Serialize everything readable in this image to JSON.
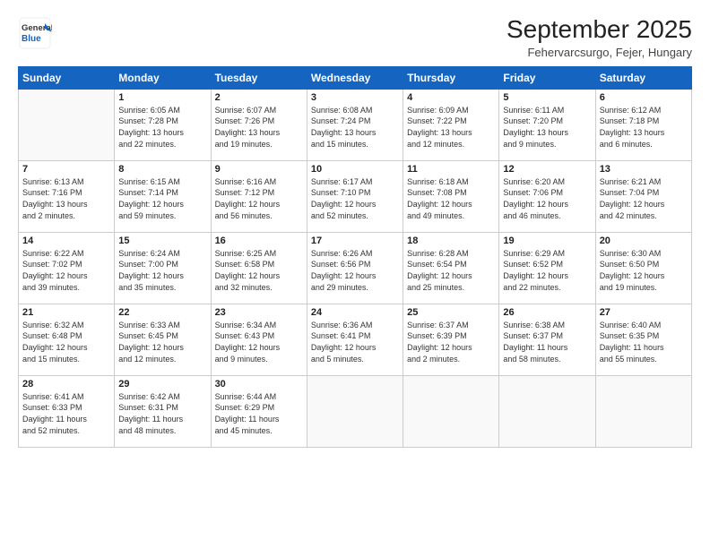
{
  "header": {
    "logo_general": "General",
    "logo_blue": "Blue",
    "month": "September 2025",
    "location": "Fehervarcsurgo, Fejer, Hungary"
  },
  "weekdays": [
    "Sunday",
    "Monday",
    "Tuesday",
    "Wednesday",
    "Thursday",
    "Friday",
    "Saturday"
  ],
  "weeks": [
    [
      {
        "day": "",
        "info": ""
      },
      {
        "day": "1",
        "info": "Sunrise: 6:05 AM\nSunset: 7:28 PM\nDaylight: 13 hours\nand 22 minutes."
      },
      {
        "day": "2",
        "info": "Sunrise: 6:07 AM\nSunset: 7:26 PM\nDaylight: 13 hours\nand 19 minutes."
      },
      {
        "day": "3",
        "info": "Sunrise: 6:08 AM\nSunset: 7:24 PM\nDaylight: 13 hours\nand 15 minutes."
      },
      {
        "day": "4",
        "info": "Sunrise: 6:09 AM\nSunset: 7:22 PM\nDaylight: 13 hours\nand 12 minutes."
      },
      {
        "day": "5",
        "info": "Sunrise: 6:11 AM\nSunset: 7:20 PM\nDaylight: 13 hours\nand 9 minutes."
      },
      {
        "day": "6",
        "info": "Sunrise: 6:12 AM\nSunset: 7:18 PM\nDaylight: 13 hours\nand 6 minutes."
      }
    ],
    [
      {
        "day": "7",
        "info": "Sunrise: 6:13 AM\nSunset: 7:16 PM\nDaylight: 13 hours\nand 2 minutes."
      },
      {
        "day": "8",
        "info": "Sunrise: 6:15 AM\nSunset: 7:14 PM\nDaylight: 12 hours\nand 59 minutes."
      },
      {
        "day": "9",
        "info": "Sunrise: 6:16 AM\nSunset: 7:12 PM\nDaylight: 12 hours\nand 56 minutes."
      },
      {
        "day": "10",
        "info": "Sunrise: 6:17 AM\nSunset: 7:10 PM\nDaylight: 12 hours\nand 52 minutes."
      },
      {
        "day": "11",
        "info": "Sunrise: 6:18 AM\nSunset: 7:08 PM\nDaylight: 12 hours\nand 49 minutes."
      },
      {
        "day": "12",
        "info": "Sunrise: 6:20 AM\nSunset: 7:06 PM\nDaylight: 12 hours\nand 46 minutes."
      },
      {
        "day": "13",
        "info": "Sunrise: 6:21 AM\nSunset: 7:04 PM\nDaylight: 12 hours\nand 42 minutes."
      }
    ],
    [
      {
        "day": "14",
        "info": "Sunrise: 6:22 AM\nSunset: 7:02 PM\nDaylight: 12 hours\nand 39 minutes."
      },
      {
        "day": "15",
        "info": "Sunrise: 6:24 AM\nSunset: 7:00 PM\nDaylight: 12 hours\nand 35 minutes."
      },
      {
        "day": "16",
        "info": "Sunrise: 6:25 AM\nSunset: 6:58 PM\nDaylight: 12 hours\nand 32 minutes."
      },
      {
        "day": "17",
        "info": "Sunrise: 6:26 AM\nSunset: 6:56 PM\nDaylight: 12 hours\nand 29 minutes."
      },
      {
        "day": "18",
        "info": "Sunrise: 6:28 AM\nSunset: 6:54 PM\nDaylight: 12 hours\nand 25 minutes."
      },
      {
        "day": "19",
        "info": "Sunrise: 6:29 AM\nSunset: 6:52 PM\nDaylight: 12 hours\nand 22 minutes."
      },
      {
        "day": "20",
        "info": "Sunrise: 6:30 AM\nSunset: 6:50 PM\nDaylight: 12 hours\nand 19 minutes."
      }
    ],
    [
      {
        "day": "21",
        "info": "Sunrise: 6:32 AM\nSunset: 6:48 PM\nDaylight: 12 hours\nand 15 minutes."
      },
      {
        "day": "22",
        "info": "Sunrise: 6:33 AM\nSunset: 6:45 PM\nDaylight: 12 hours\nand 12 minutes."
      },
      {
        "day": "23",
        "info": "Sunrise: 6:34 AM\nSunset: 6:43 PM\nDaylight: 12 hours\nand 9 minutes."
      },
      {
        "day": "24",
        "info": "Sunrise: 6:36 AM\nSunset: 6:41 PM\nDaylight: 12 hours\nand 5 minutes."
      },
      {
        "day": "25",
        "info": "Sunrise: 6:37 AM\nSunset: 6:39 PM\nDaylight: 12 hours\nand 2 minutes."
      },
      {
        "day": "26",
        "info": "Sunrise: 6:38 AM\nSunset: 6:37 PM\nDaylight: 11 hours\nand 58 minutes."
      },
      {
        "day": "27",
        "info": "Sunrise: 6:40 AM\nSunset: 6:35 PM\nDaylight: 11 hours\nand 55 minutes."
      }
    ],
    [
      {
        "day": "28",
        "info": "Sunrise: 6:41 AM\nSunset: 6:33 PM\nDaylight: 11 hours\nand 52 minutes."
      },
      {
        "day": "29",
        "info": "Sunrise: 6:42 AM\nSunset: 6:31 PM\nDaylight: 11 hours\nand 48 minutes."
      },
      {
        "day": "30",
        "info": "Sunrise: 6:44 AM\nSunset: 6:29 PM\nDaylight: 11 hours\nand 45 minutes."
      },
      {
        "day": "",
        "info": ""
      },
      {
        "day": "",
        "info": ""
      },
      {
        "day": "",
        "info": ""
      },
      {
        "day": "",
        "info": ""
      }
    ]
  ]
}
